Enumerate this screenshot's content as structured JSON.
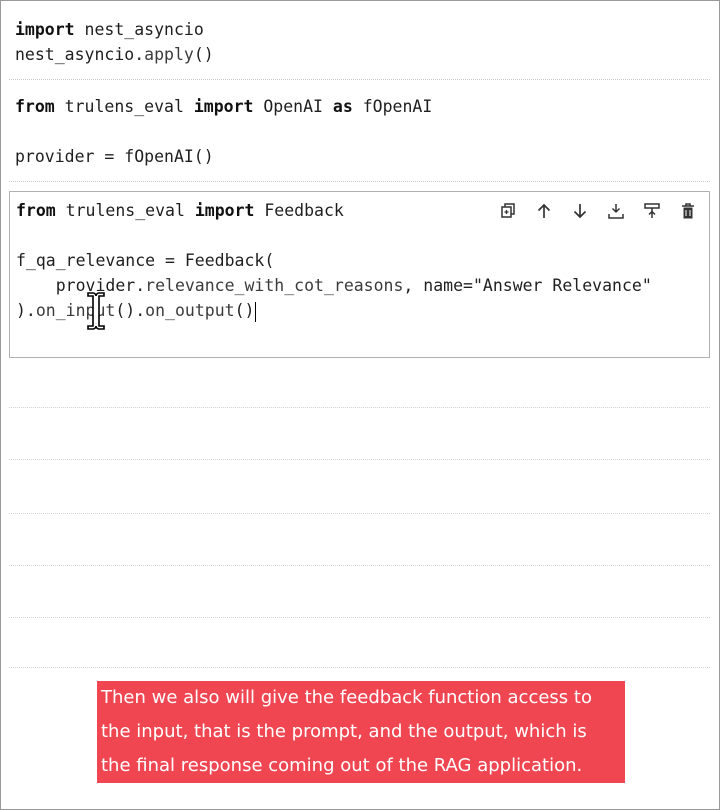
{
  "cells": [
    {
      "lines": [
        [
          {
            "t": "import",
            "k": "kw"
          },
          {
            "t": " nest_asyncio",
            "k": ""
          }
        ],
        [
          {
            "t": "nest_asyncio.",
            "k": ""
          },
          {
            "t": "apply",
            "k": "fn"
          },
          {
            "t": "()",
            "k": ""
          }
        ]
      ]
    },
    {
      "lines": [
        [
          {
            "t": "from",
            "k": "kw"
          },
          {
            "t": " trulens_eval ",
            "k": ""
          },
          {
            "t": "import",
            "k": "kw"
          },
          {
            "t": " OpenAI ",
            "k": ""
          },
          {
            "t": "as",
            "k": "kw"
          },
          {
            "t": " fOpenAI",
            "k": ""
          }
        ],
        [
          {
            "t": "",
            "k": ""
          }
        ],
        [
          {
            "t": "provider = fOpenAI()",
            "k": ""
          }
        ]
      ]
    }
  ],
  "active_cell": {
    "lines": [
      [
        {
          "t": "from",
          "k": "kw"
        },
        {
          "t": " trulens_eval ",
          "k": ""
        },
        {
          "t": "import",
          "k": "kw"
        },
        {
          "t": " Feedback",
          "k": ""
        }
      ],
      [
        {
          "t": "",
          "k": ""
        }
      ],
      [
        {
          "t": "f_qa_relevance = Feedback(",
          "k": ""
        }
      ],
      [
        {
          "t": "    provider.",
          "k": ""
        },
        {
          "t": "relevance_with_cot_reasons",
          "k": "fn"
        },
        {
          "t": ", name=\"Answer Relevance\"",
          "k": ""
        }
      ],
      [
        {
          "t": ").",
          "k": ""
        },
        {
          "t": "on_input",
          "k": "fn"
        },
        {
          "t": "().",
          "k": ""
        },
        {
          "t": "on_output",
          "k": "fn"
        },
        {
          "t": "()",
          "k": ""
        }
      ]
    ],
    "toolbar": [
      {
        "name": "duplicate-cell-icon"
      },
      {
        "name": "move-up-icon"
      },
      {
        "name": "move-down-icon"
      },
      {
        "name": "insert-above-icon"
      },
      {
        "name": "insert-below-icon"
      },
      {
        "name": "delete-cell-icon"
      }
    ]
  },
  "caption": {
    "lines": [
      "Then we also will give the feedback function access to",
      "the input, that is the prompt, and the output, which is",
      "the final response coming out of the RAG application."
    ]
  }
}
